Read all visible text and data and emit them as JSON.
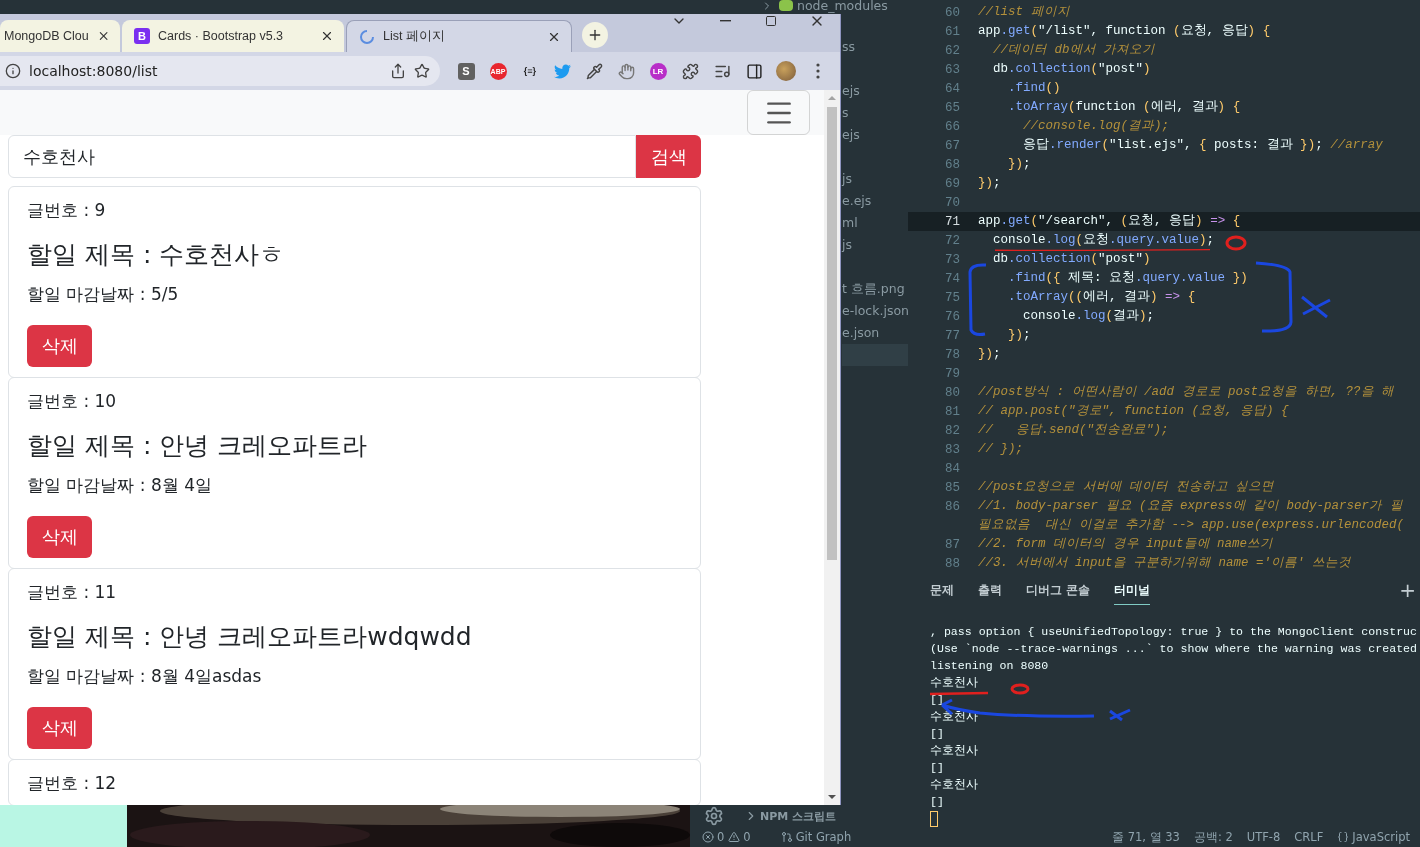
{
  "browser": {
    "tabs": [
      {
        "title": "MongoDB Clou",
        "selected": false
      },
      {
        "title": "Cards · Bootstrap v5.3",
        "selected": false,
        "favicon": {
          "kind": "letter",
          "text": "B"
        }
      },
      {
        "title": "List 페이지",
        "selected": true,
        "favicon": {
          "kind": "spinner"
        }
      }
    ],
    "url": "localhost:8080/list",
    "extensions": [
      {
        "kind": "square-badge",
        "text": "S"
      },
      {
        "kind": "stop-badge",
        "text": "ABP"
      },
      {
        "kind": "text",
        "text": "{≡}"
      },
      {
        "kind": "bird"
      },
      {
        "kind": "eyedropper"
      },
      {
        "kind": "hand"
      },
      {
        "kind": "round-badge",
        "text": "LR"
      },
      {
        "kind": "puzzle"
      },
      {
        "kind": "media"
      },
      {
        "kind": "sidebar"
      },
      {
        "kind": "avatar"
      },
      {
        "kind": "menu"
      }
    ]
  },
  "page": {
    "search": {
      "value": "수호천사",
      "button": "검색"
    },
    "posts": [
      {
        "number": "글번호 : 9",
        "title": "할일 제목 : 수호천사ㅎ",
        "due": "할일 마감날짜 : 5/5",
        "button": "삭제"
      },
      {
        "number": "글번호 : 10",
        "title": "할일 제목 : 안녕 크레오파트라",
        "due": "할일 마감날짜 : 8월 4일",
        "button": "삭제"
      },
      {
        "number": "글번호 : 11",
        "title": "할일 제목 : 안녕 크레오파트라wdqwdd",
        "due": "할일 마감날짜 : 8월 4일asdas",
        "button": "삭제"
      },
      {
        "number": "글번호 : 12"
      }
    ]
  },
  "vscode": {
    "explorer": [
      {
        "name": "node_modules",
        "kind": "folder"
      },
      {
        "name": "ss",
        "kind": "file"
      },
      {
        "name": "ejs",
        "kind": "file"
      },
      {
        "name": "s",
        "kind": "file"
      },
      {
        "name": "ejs",
        "kind": "file"
      },
      {
        "name": "js",
        "kind": "file"
      },
      {
        "name": "e.ejs",
        "kind": "file"
      },
      {
        "name": "ml",
        "kind": "file"
      },
      {
        "name": "js",
        "kind": "file"
      },
      {
        "name": "t 흐름.png",
        "kind": "file"
      },
      {
        "name": "e-lock.json",
        "kind": "file"
      },
      {
        "name": "e.json",
        "kind": "file"
      }
    ],
    "npm_section": "NPM 스크립트",
    "lines": [
      {
        "kind": "code",
        "number": "60",
        "current": false,
        "text": "//list 페이지"
      },
      {
        "kind": "code",
        "number": "61",
        "current": false,
        "text": "app.get(\"/list\", function (요청, 응답) {"
      },
      {
        "kind": "code",
        "number": "62",
        "current": false,
        "text": "  //데이터 db에서 가져오기"
      },
      {
        "kind": "code",
        "number": "63",
        "current": false,
        "text": "  db.collection(\"post\")"
      },
      {
        "kind": "code",
        "number": "64",
        "current": false,
        "text": "    .find()"
      },
      {
        "kind": "code",
        "number": "65",
        "current": false,
        "text": "    .toArray(function (에러, 결과) {"
      },
      {
        "kind": "code",
        "number": "66",
        "current": false,
        "text": "      //console.log(결과);"
      },
      {
        "kind": "code",
        "number": "67",
        "current": false,
        "text": "      응답.render(\"list.ejs\", { posts: 결과 }); //array"
      },
      {
        "kind": "code",
        "number": "68",
        "current": false,
        "text": "    });"
      },
      {
        "kind": "code",
        "number": "69",
        "current": false,
        "text": "});"
      },
      {
        "kind": "code",
        "number": "70",
        "current": false
      },
      {
        "kind": "code",
        "number": "71",
        "current": true,
        "text": "app.get(\"/search\", (요청, 응답) => {"
      },
      {
        "kind": "code",
        "number": "72",
        "current": false,
        "text": "  console.log(요청.query.value);"
      },
      {
        "kind": "code",
        "number": "73",
        "current": false,
        "text": "  db.collection(\"post\")"
      },
      {
        "kind": "code",
        "number": "74",
        "current": false,
        "text": "    .find({ 제목: 요청.query.value })"
      },
      {
        "kind": "code",
        "number": "75",
        "current": false,
        "text": "    .toArray((에러, 결과) => {"
      },
      {
        "kind": "code",
        "number": "76",
        "current": false,
        "text": "      console.log(결과);"
      },
      {
        "kind": "code",
        "number": "77",
        "current": false,
        "text": "    });"
      },
      {
        "kind": "code",
        "number": "78",
        "current": false,
        "text": "});"
      },
      {
        "kind": "code",
        "number": "79",
        "current": false
      },
      {
        "kind": "code",
        "number": "80",
        "current": false,
        "text": "//post방식 : 어떤사람이 /add 경로로 post요청을 하면, ??을 해"
      },
      {
        "kind": "code",
        "number": "81",
        "current": false,
        "text": "// app.post(\"경로\", function (요청, 응답) {"
      },
      {
        "kind": "code",
        "number": "82",
        "current": false,
        "text": "//   응답.send(\"전송완료\");"
      },
      {
        "kind": "code",
        "number": "83",
        "current": false,
        "text": "// });"
      },
      {
        "kind": "code",
        "number": "84",
        "current": false
      },
      {
        "kind": "code",
        "number": "85",
        "current": false,
        "text": "//post요청으로 서버에 데이터 전송하고 싶으면"
      },
      {
        "kind": "code",
        "number": "86",
        "current": false,
        "text": "//1. body-parser 필요 (요즘 express에 같이 body-parser가 필"
      },
      {
        "kind": "wrap",
        "current": false,
        "text": "필요없음  대신 이걸로 추가함 --> app.use(express.urlencoded("
      },
      {
        "kind": "code",
        "number": "87",
        "current": false,
        "text": "//2. form 데이터의 경우 input들에 name쓰기"
      },
      {
        "kind": "code",
        "number": "88",
        "current": false,
        "text": "//3. 서버에서 input을 구분하기위해 name ='이름' 쓰는것"
      }
    ],
    "panel_tabs": [
      {
        "label": "문제",
        "selected": false
      },
      {
        "label": "출력",
        "selected": false
      },
      {
        "label": "디버그 콘솔",
        "selected": false
      },
      {
        "label": "터미널",
        "selected": true
      }
    ],
    "panel_add": "+",
    "terminal": [
      ", pass option { useUnifiedTopology: true } to the MongoClient construc",
      "(Use `node --trace-warnings ...` to show where the warning was created",
      "listening on 8080",
      "수호천사",
      "[]",
      "수호천사",
      "[]",
      "수호천사",
      "[]",
      "수호천사",
      "[]"
    ],
    "status": {
      "errors": "0",
      "warnings": "0",
      "git": "Git Graph",
      "right": [
        {
          "text": "줄 71, 열 33"
        },
        {
          "text": "공백: 2"
        },
        {
          "text": "UTF-8"
        },
        {
          "text": "CRLF"
        },
        {
          "text": "JavaScript",
          "kind": "language"
        }
      ]
    }
  }
}
